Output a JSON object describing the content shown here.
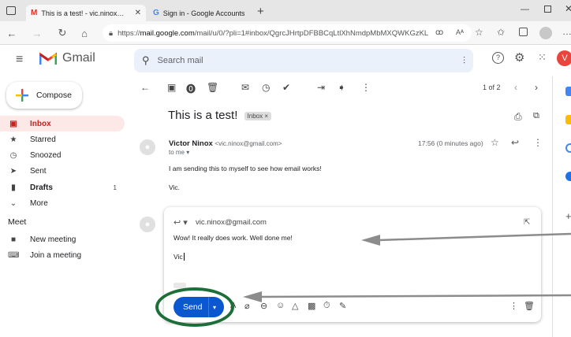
{
  "browser": {
    "tabs": [
      {
        "title": "This is a test! - vic.ninox@gmail.c"
      },
      {
        "title": "Sign in - Google Accounts"
      }
    ],
    "url_prefix": "https://",
    "url_host": "mail.google.com",
    "url_rest": "/mail/u/0/?pli=1#inbox/QgrcJHrtpDFBBCqLtlXhNmdpMbMXQWKGzKL"
  },
  "gmail": {
    "logo_text": "Gmail",
    "search_placeholder": "Search mail",
    "compose_label": "Compose",
    "nav": [
      {
        "label": "Inbox",
        "icon": "inbox-icon",
        "count": ""
      },
      {
        "label": "Starred",
        "icon": "star-icon",
        "count": ""
      },
      {
        "label": "Snoozed",
        "icon": "clock-icon",
        "count": ""
      },
      {
        "label": "Sent",
        "icon": "send-icon",
        "count": ""
      },
      {
        "label": "Drafts",
        "icon": "draft-icon",
        "count": "1"
      },
      {
        "label": "More",
        "icon": "chevron-down-icon",
        "count": ""
      }
    ],
    "meet_heading": "Meet",
    "meet_items": [
      {
        "label": "New meeting",
        "icon": "videocam-icon"
      },
      {
        "label": "Join a meeting",
        "icon": "keyboard-icon"
      }
    ],
    "pagination": "1 of 2",
    "avatar_letter": "V"
  },
  "message": {
    "subject": "This is a test!",
    "label_chip": "Inbox ×",
    "sender_name": "Victor Ninox",
    "sender_email": "<vic.ninox@gmail.com>",
    "to": "to me ▾",
    "time": "17:56 (0 minutes ago)",
    "body_line1": "I am sending this to myself to see how email works!",
    "body_line2": "Vic."
  },
  "reply": {
    "recipient": "vic.ninox@gmail.com",
    "body_line1": "Wow! It really does work. Well done me!",
    "body_line2": "Vic",
    "send_label": "Send"
  },
  "colors": {
    "send": "#0b57d0",
    "inbox_active_bg": "#fce8e6",
    "annotation_circle": "#1e6e3a",
    "annotation_arrow": "#8c8c8c"
  }
}
